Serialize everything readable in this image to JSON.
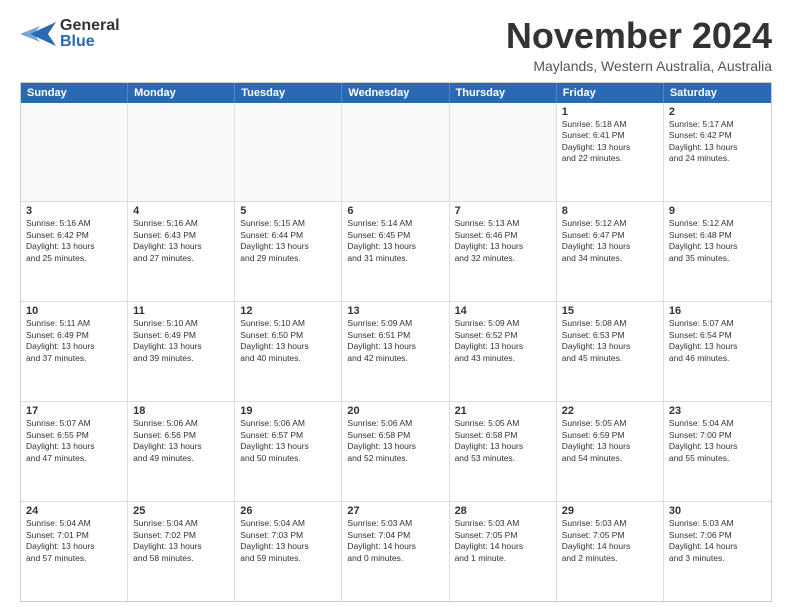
{
  "header": {
    "logo_general": "General",
    "logo_blue": "Blue",
    "month_title": "November 2024",
    "location": "Maylands, Western Australia, Australia"
  },
  "calendar": {
    "days_of_week": [
      "Sunday",
      "Monday",
      "Tuesday",
      "Wednesday",
      "Thursday",
      "Friday",
      "Saturday"
    ],
    "weeks": [
      [
        {
          "day": "",
          "info": ""
        },
        {
          "day": "",
          "info": ""
        },
        {
          "day": "",
          "info": ""
        },
        {
          "day": "",
          "info": ""
        },
        {
          "day": "",
          "info": ""
        },
        {
          "day": "1",
          "info": "Sunrise: 5:18 AM\nSunset: 6:41 PM\nDaylight: 13 hours\nand 22 minutes."
        },
        {
          "day": "2",
          "info": "Sunrise: 5:17 AM\nSunset: 6:42 PM\nDaylight: 13 hours\nand 24 minutes."
        }
      ],
      [
        {
          "day": "3",
          "info": "Sunrise: 5:16 AM\nSunset: 6:42 PM\nDaylight: 13 hours\nand 25 minutes."
        },
        {
          "day": "4",
          "info": "Sunrise: 5:16 AM\nSunset: 6:43 PM\nDaylight: 13 hours\nand 27 minutes."
        },
        {
          "day": "5",
          "info": "Sunrise: 5:15 AM\nSunset: 6:44 PM\nDaylight: 13 hours\nand 29 minutes."
        },
        {
          "day": "6",
          "info": "Sunrise: 5:14 AM\nSunset: 6:45 PM\nDaylight: 13 hours\nand 31 minutes."
        },
        {
          "day": "7",
          "info": "Sunrise: 5:13 AM\nSunset: 6:46 PM\nDaylight: 13 hours\nand 32 minutes."
        },
        {
          "day": "8",
          "info": "Sunrise: 5:12 AM\nSunset: 6:47 PM\nDaylight: 13 hours\nand 34 minutes."
        },
        {
          "day": "9",
          "info": "Sunrise: 5:12 AM\nSunset: 6:48 PM\nDaylight: 13 hours\nand 35 minutes."
        }
      ],
      [
        {
          "day": "10",
          "info": "Sunrise: 5:11 AM\nSunset: 6:49 PM\nDaylight: 13 hours\nand 37 minutes."
        },
        {
          "day": "11",
          "info": "Sunrise: 5:10 AM\nSunset: 6:49 PM\nDaylight: 13 hours\nand 39 minutes."
        },
        {
          "day": "12",
          "info": "Sunrise: 5:10 AM\nSunset: 6:50 PM\nDaylight: 13 hours\nand 40 minutes."
        },
        {
          "day": "13",
          "info": "Sunrise: 5:09 AM\nSunset: 6:51 PM\nDaylight: 13 hours\nand 42 minutes."
        },
        {
          "day": "14",
          "info": "Sunrise: 5:09 AM\nSunset: 6:52 PM\nDaylight: 13 hours\nand 43 minutes."
        },
        {
          "day": "15",
          "info": "Sunrise: 5:08 AM\nSunset: 6:53 PM\nDaylight: 13 hours\nand 45 minutes."
        },
        {
          "day": "16",
          "info": "Sunrise: 5:07 AM\nSunset: 6:54 PM\nDaylight: 13 hours\nand 46 minutes."
        }
      ],
      [
        {
          "day": "17",
          "info": "Sunrise: 5:07 AM\nSunset: 6:55 PM\nDaylight: 13 hours\nand 47 minutes."
        },
        {
          "day": "18",
          "info": "Sunrise: 5:06 AM\nSunset: 6:56 PM\nDaylight: 13 hours\nand 49 minutes."
        },
        {
          "day": "19",
          "info": "Sunrise: 5:06 AM\nSunset: 6:57 PM\nDaylight: 13 hours\nand 50 minutes."
        },
        {
          "day": "20",
          "info": "Sunrise: 5:06 AM\nSunset: 6:58 PM\nDaylight: 13 hours\nand 52 minutes."
        },
        {
          "day": "21",
          "info": "Sunrise: 5:05 AM\nSunset: 6:58 PM\nDaylight: 13 hours\nand 53 minutes."
        },
        {
          "day": "22",
          "info": "Sunrise: 5:05 AM\nSunset: 6:59 PM\nDaylight: 13 hours\nand 54 minutes."
        },
        {
          "day": "23",
          "info": "Sunrise: 5:04 AM\nSunset: 7:00 PM\nDaylight: 13 hours\nand 55 minutes."
        }
      ],
      [
        {
          "day": "24",
          "info": "Sunrise: 5:04 AM\nSunset: 7:01 PM\nDaylight: 13 hours\nand 57 minutes."
        },
        {
          "day": "25",
          "info": "Sunrise: 5:04 AM\nSunset: 7:02 PM\nDaylight: 13 hours\nand 58 minutes."
        },
        {
          "day": "26",
          "info": "Sunrise: 5:04 AM\nSunset: 7:03 PM\nDaylight: 13 hours\nand 59 minutes."
        },
        {
          "day": "27",
          "info": "Sunrise: 5:03 AM\nSunset: 7:04 PM\nDaylight: 14 hours\nand 0 minutes."
        },
        {
          "day": "28",
          "info": "Sunrise: 5:03 AM\nSunset: 7:05 PM\nDaylight: 14 hours\nand 1 minute."
        },
        {
          "day": "29",
          "info": "Sunrise: 5:03 AM\nSunset: 7:05 PM\nDaylight: 14 hours\nand 2 minutes."
        },
        {
          "day": "30",
          "info": "Sunrise: 5:03 AM\nSunset: 7:06 PM\nDaylight: 14 hours\nand 3 minutes."
        }
      ]
    ]
  }
}
